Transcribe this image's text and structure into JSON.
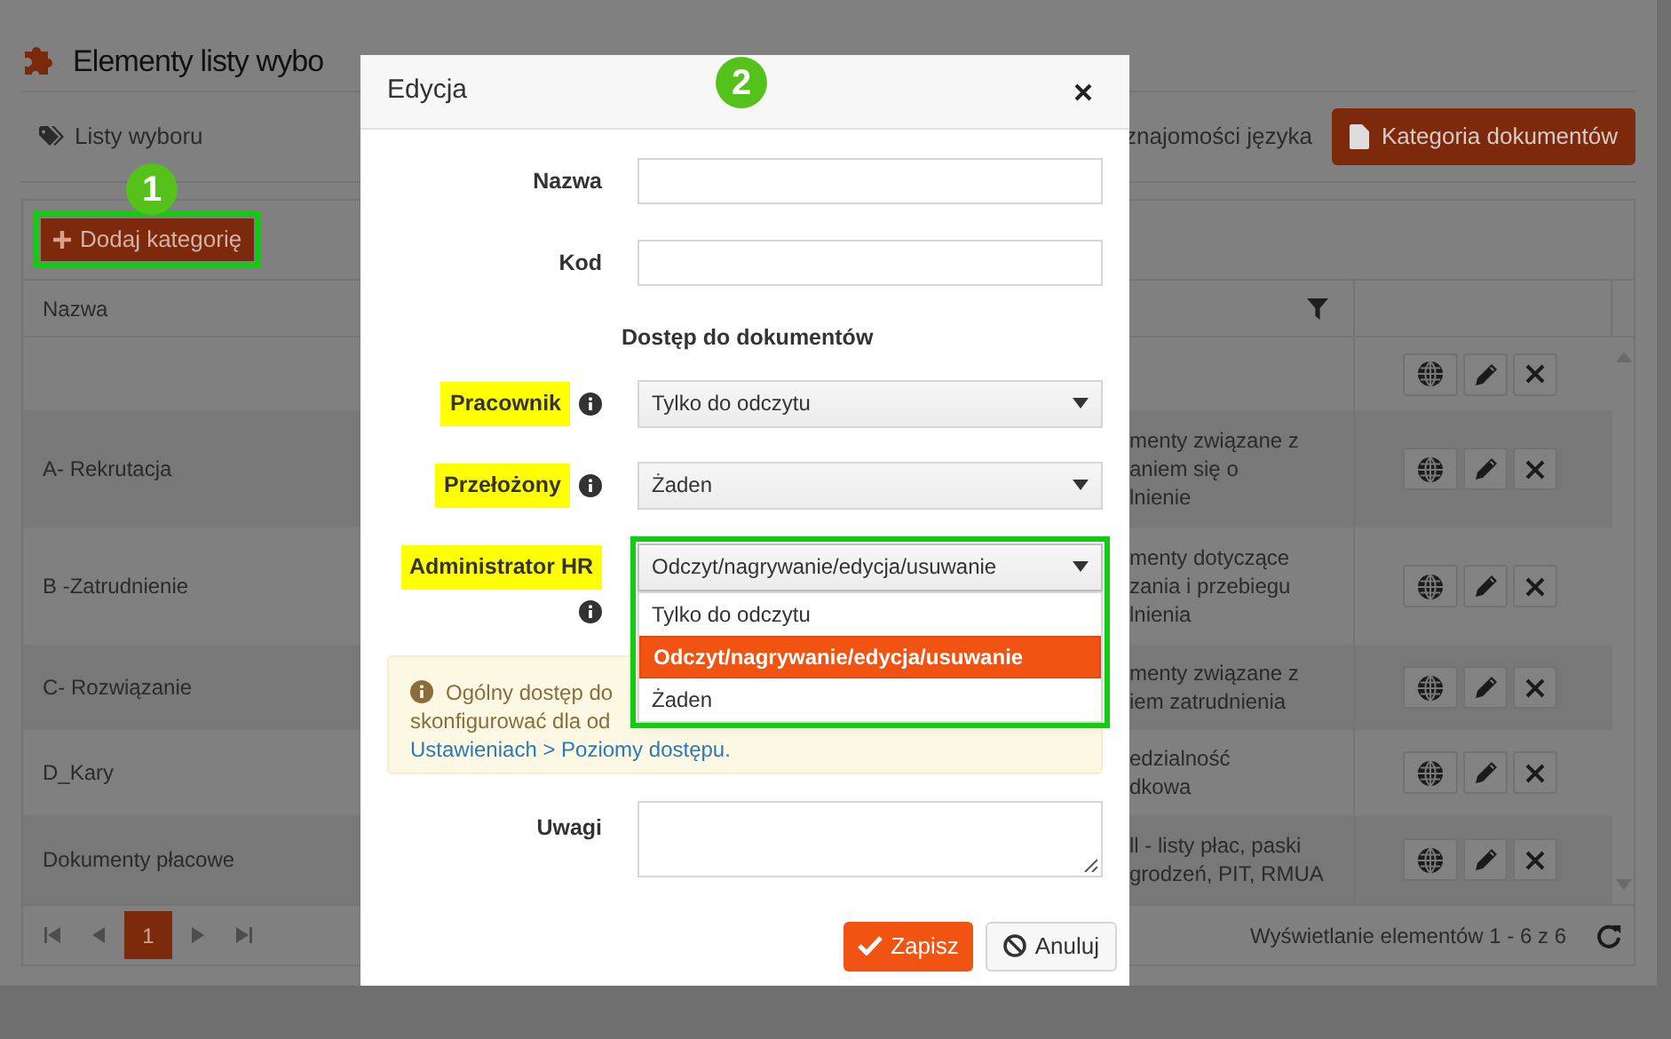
{
  "page": {
    "title": "Elementy listy wybo",
    "breadcrumb": "Listy wyboru",
    "tab_fragment": "znajomości języka",
    "category_button": "Kategoria dokumentów"
  },
  "toolbar": {
    "add_button": "Dodaj kategorię",
    "annotation": "1"
  },
  "table": {
    "columns": [
      {
        "label": "Nazwa"
      }
    ],
    "rows": [
      {
        "name": "",
        "description": []
      },
      {
        "name": "A- Rekrutacja",
        "description": [
          "menty związane z",
          "aniem się o",
          "lnienie"
        ]
      },
      {
        "name": "B -Zatrudnienie",
        "description": [
          "menty dotyczące",
          "zania i przebiegu",
          "lnienia"
        ]
      },
      {
        "name": "C- Rozwiązanie",
        "description": [
          "menty związane z",
          "iem zatrudnienia"
        ]
      },
      {
        "name": "D_Kary",
        "description": [
          "edzialność",
          "dkowa"
        ]
      },
      {
        "name": "Dokumenty płacowe",
        "description": [
          "ll - listy płac, paski",
          "grodzeń, PIT, RMUA"
        ]
      }
    ]
  },
  "pager": {
    "pages": [
      {
        "label": "1",
        "selected": true
      }
    ],
    "info": "Wyświetlanie elementów 1 - 6 z 6"
  },
  "dialog": {
    "title": "Edycja",
    "annotation": "2",
    "fields": [
      {
        "kind": "input",
        "label": "Nazwa",
        "highlighted": false
      },
      {
        "kind": "input",
        "label": "Kod",
        "highlighted": false
      },
      {
        "kind": "heading",
        "label": "Dostęp do dokumentów"
      },
      {
        "kind": "select",
        "label": "Pracownik",
        "highlighted": true,
        "value": "Tylko do odczytu",
        "expanded": false
      },
      {
        "kind": "select",
        "label": "Przełożony",
        "highlighted": true,
        "value": "Żaden",
        "expanded": false
      },
      {
        "kind": "select",
        "label": "Administrator HR",
        "highlighted": true,
        "value": "Odczyt/nagrywanie/edycja/usuwanie",
        "expanded": true,
        "options": [
          {
            "label": "Tylko do odczytu",
            "selected": false
          },
          {
            "label": "Odczyt/nagrywanie/edycja/usuwanie",
            "selected": true
          },
          {
            "label": "Żaden",
            "selected": false
          }
        ]
      },
      {
        "kind": "alert",
        "lines": [
          "Ogólny dostęp do",
          "skonfigurować dla od"
        ],
        "link": "Ustawieniach > Poziomy dostępu."
      },
      {
        "kind": "textarea",
        "label": "Uwagi",
        "highlighted": false
      }
    ],
    "buttons": [
      {
        "kind": "primary",
        "label": "Zapisz"
      },
      {
        "kind": "secondary",
        "label": "Anuluj"
      }
    ]
  }
}
